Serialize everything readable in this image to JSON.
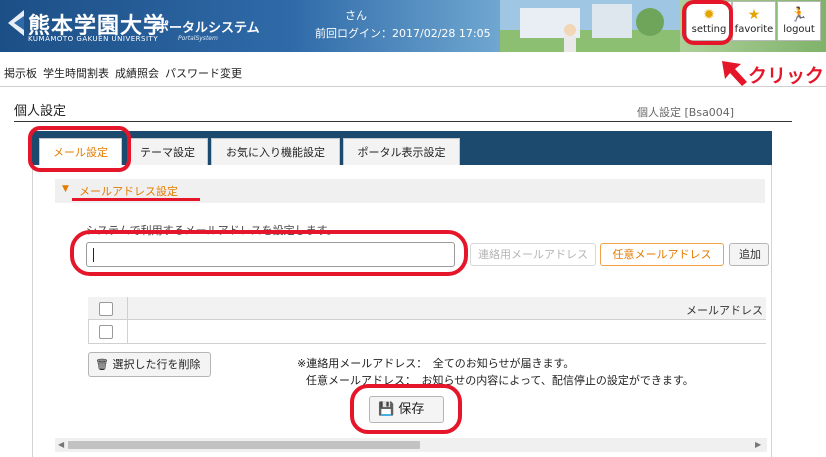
{
  "header": {
    "logo_ja": "熊本学園大学",
    "logo_en": "KUMAMOTO GAKUEN UNIVERSITY",
    "logo_sub": "ポータルシステム",
    "logo_sub_en": "PortalSystem",
    "user_text": "さん",
    "last_login": "前回ログイン：2017/02/28 17:05",
    "buttons": [
      {
        "label": "setting",
        "icon": "gear-icon"
      },
      {
        "label": "favorite",
        "icon": "star-icon"
      },
      {
        "label": "logout",
        "icon": "running-person-icon"
      }
    ]
  },
  "annotation": {
    "click_label": "クリック",
    "color": "#e5162a"
  },
  "nav": {
    "items": [
      "掲示板",
      "学生時間割表",
      "成績照会",
      "パスワード変更"
    ]
  },
  "page": {
    "title": "個人設定",
    "code": "個人設定 [Bsa004]"
  },
  "tabs": [
    {
      "label": "メール設定",
      "active": true
    },
    {
      "label": "テーマ設定",
      "active": false
    },
    {
      "label": "お気に入り機能設定",
      "active": false
    },
    {
      "label": "ポータル表示設定",
      "active": false
    }
  ],
  "section": {
    "title": "メールアドレス設定",
    "description": "システムで利用するメールアドレスを設定します。",
    "email_value": "",
    "buttons": {
      "contact": "連絡用メールアドレス",
      "optional": "任意メールアドレス",
      "add": "追加"
    }
  },
  "table": {
    "column_header": "メールアドレス"
  },
  "actions": {
    "delete_selected": "選択した行を削除",
    "save": "保存"
  },
  "notes": [
    "※連絡用メールアドレス：　全てのお知らせが届きます。",
    "任意メールアドレス：　お知らせの内容によって、配信停止の設定ができます。"
  ],
  "colors": {
    "tab_bar": "#1b4a6e",
    "accent_orange": "#e37c00",
    "highlight_red": "#e5162a"
  }
}
